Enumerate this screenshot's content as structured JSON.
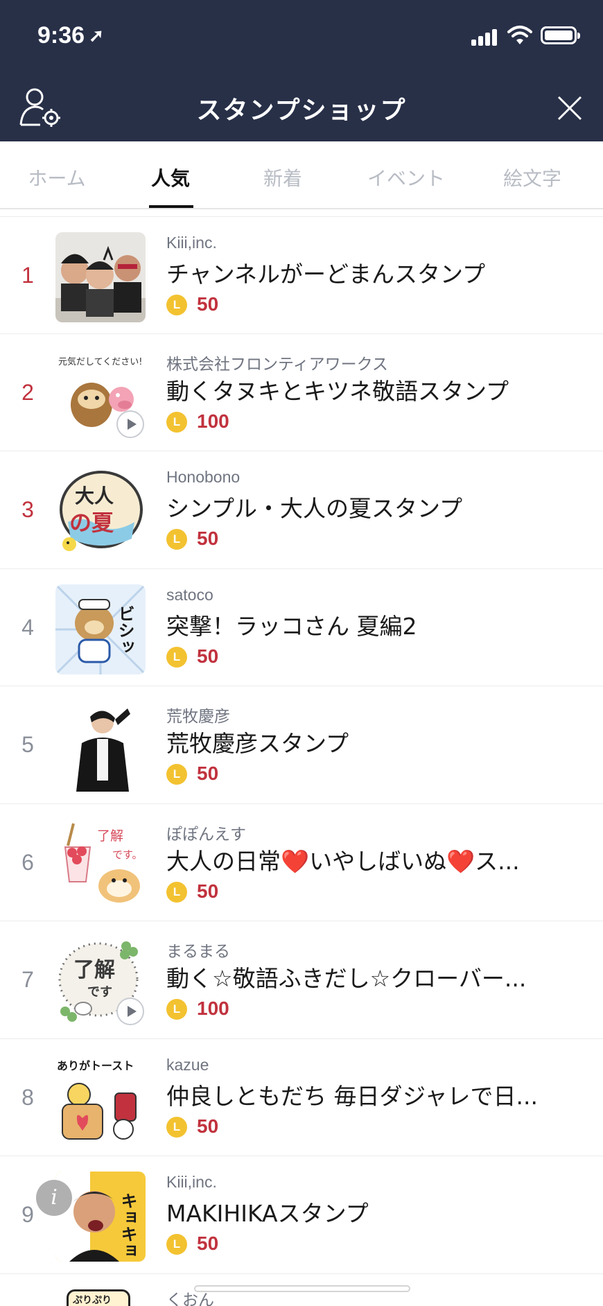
{
  "status_bar": {
    "time": "9:36",
    "location_glyph": "➚"
  },
  "header": {
    "title": "スタンプショップ"
  },
  "tabs": [
    {
      "label": "ホーム",
      "active": false
    },
    {
      "label": "人気",
      "active": true
    },
    {
      "label": "新着",
      "active": false
    },
    {
      "label": "イベント",
      "active": false
    },
    {
      "label": "絵文字",
      "active": false
    }
  ],
  "coin_letter": "L",
  "items": [
    {
      "rank": "1",
      "author": "Kiii,inc.",
      "name": "チャンネルがーどまんスタンプ",
      "price": "50",
      "animated": false
    },
    {
      "rank": "2",
      "author": "株式会社フロンティアワークス",
      "name": "動くタヌキとキツネ敬語スタンプ",
      "price": "100",
      "animated": true
    },
    {
      "rank": "3",
      "author": "Honobono",
      "name": "シンプル・大人の夏スタンプ",
      "price": "50",
      "animated": false
    },
    {
      "rank": "4",
      "author": "satoco",
      "name": "突撃！ラッコさん 夏編2",
      "price": "50",
      "animated": false
    },
    {
      "rank": "5",
      "author": "荒牧慶彦",
      "name": "荒牧慶彦スタンプ",
      "price": "50",
      "animated": false
    },
    {
      "rank": "6",
      "author": "ぽぽんえす",
      "name": "大人の日常❤️いやしばいぬ❤️ス...",
      "price": "50",
      "animated": false
    },
    {
      "rank": "7",
      "author": "まるまる",
      "name": "動く☆敬語ふきだし☆クローバー...",
      "price": "100",
      "animated": true
    },
    {
      "rank": "8",
      "author": "kazue",
      "name": "仲良しともだち 毎日ダジャレで日...",
      "price": "50",
      "animated": false
    },
    {
      "rank": "9",
      "author": "Kiii,inc.",
      "name": "MAKIHIKAスタンプ",
      "price": "50",
      "animated": false
    }
  ],
  "peek_item": {
    "author": "くおん"
  },
  "sticker_texts": {
    "s2": "元気だしてください!",
    "s3_line1": "大人",
    "s3_line2": "の夏",
    "s4": "ビシッ",
    "s6_a": "了解",
    "s6_b": "です。",
    "s7_a": "了解",
    "s7_b": "です",
    "s8": "ありがトースト",
    "s9": "キョキョ",
    "peek": "ぷりぷり"
  },
  "info_glyph": "i",
  "colors": {
    "header_bg": "#283048",
    "rank_top": "#c1323e",
    "price": "#c1323e",
    "coin": "#f3c230"
  }
}
